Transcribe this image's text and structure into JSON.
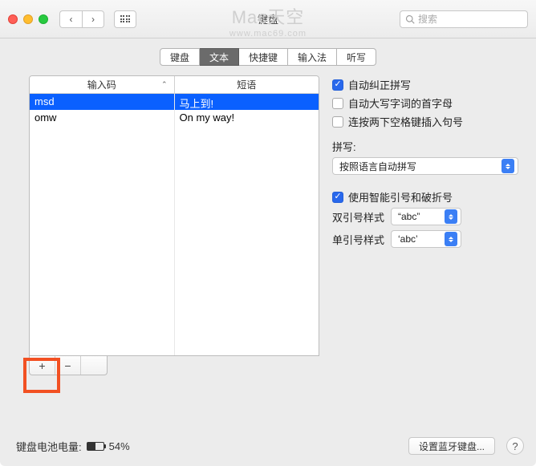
{
  "window": {
    "title": "键盘"
  },
  "watermark": {
    "line1": "Mac天空",
    "line2": "www.mac69.com"
  },
  "search": {
    "placeholder": "搜索"
  },
  "tabs": [
    "键盘",
    "文本",
    "快捷键",
    "输入法",
    "听写"
  ],
  "active_tab_index": 1,
  "table": {
    "columns": [
      "输入码",
      "短语"
    ],
    "rows": [
      {
        "code": "msd",
        "phrase": "马上到!",
        "selected": true
      },
      {
        "code": "omw",
        "phrase": "On my way!",
        "selected": false
      }
    ]
  },
  "options": {
    "auto_correct": {
      "label": "自动纠正拼写",
      "checked": true
    },
    "auto_capitalize": {
      "label": "自动大写字词的首字母",
      "checked": false
    },
    "double_space_period": {
      "label": "连按两下空格键插入句号",
      "checked": false
    },
    "spelling_label": "拼写:",
    "spelling_value": "按照语言自动拼写",
    "smart_quotes": {
      "label": "使用智能引号和破折号",
      "checked": true
    },
    "double_quote_label": "双引号样式",
    "double_quote_value": "“abc”",
    "single_quote_label": "单引号样式",
    "single_quote_value": "‘abc’"
  },
  "footer": {
    "battery_label": "键盘电池电量:",
    "battery_percent": "54%",
    "battery_fill": 54,
    "bt_button": "设置蓝牙键盘..."
  }
}
